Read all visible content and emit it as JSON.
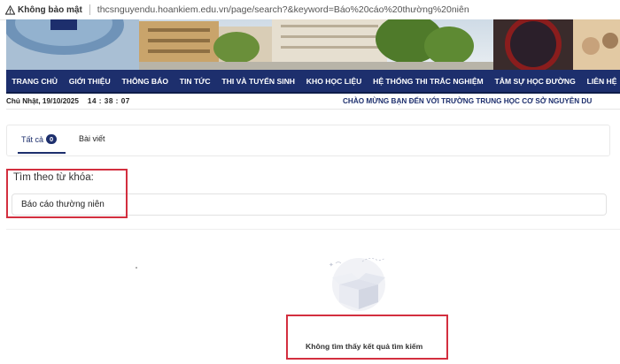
{
  "browser": {
    "security_label": "Không bảo mật",
    "url": "thcsnguyendu.hoankiem.edu.vn/page/search?&keyword=Báo%20cáo%20thường%20niên"
  },
  "nav": {
    "items": [
      "TRANG CHỦ",
      "GIỚI THIỆU",
      "THÔNG BÁO",
      "TIN TỨC",
      "THI VÀ TUYỂN SINH",
      "KHO HỌC LIỆU",
      "HỆ THỐNG THI TRẮC NGHIỆM",
      "TÂM SỰ HỌC ĐƯỜNG",
      "LIÊN HỆ"
    ]
  },
  "infobar": {
    "date": "Chủ Nhật, 19/10/2025",
    "time": "14 : 38 : 07",
    "welcome": "CHÀO MỪNG BẠN ĐẾN VỚI TRƯỜNG TRUNG HỌC CƠ SỞ NGUYỄN DU"
  },
  "tabs": {
    "all_label": "Tất cả",
    "all_count": "0",
    "posts_label": "Bài viết"
  },
  "search": {
    "label": "Tìm theo từ khóa:",
    "value": "Báo cáo thường niên"
  },
  "empty_state": {
    "message": "Không tìm thấy kết quả tìm kiếm"
  },
  "colors": {
    "nav_bg": "#1d2f6d",
    "highlight": "#d32f3f"
  }
}
